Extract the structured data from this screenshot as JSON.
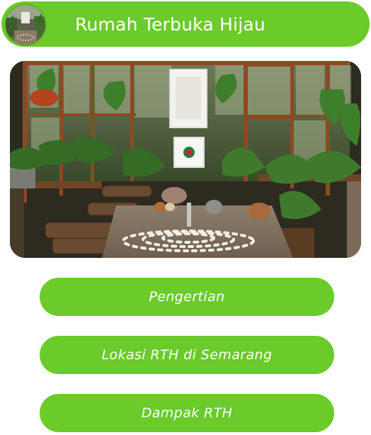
{
  "header": {
    "title": "Rumah Terbuka Hijau",
    "avatar_icon": "greenhouse-thumbnail",
    "accent_color": "#6acb2a"
  },
  "hero": {
    "image_icon": "greenhouse-photo"
  },
  "menu": {
    "items": [
      {
        "label": "Pengertian"
      },
      {
        "label": "Lokasi RTH di Semarang"
      },
      {
        "label": "Dampak RTH"
      }
    ],
    "button_color": "#6acb2a",
    "text_color": "#ffffff"
  }
}
